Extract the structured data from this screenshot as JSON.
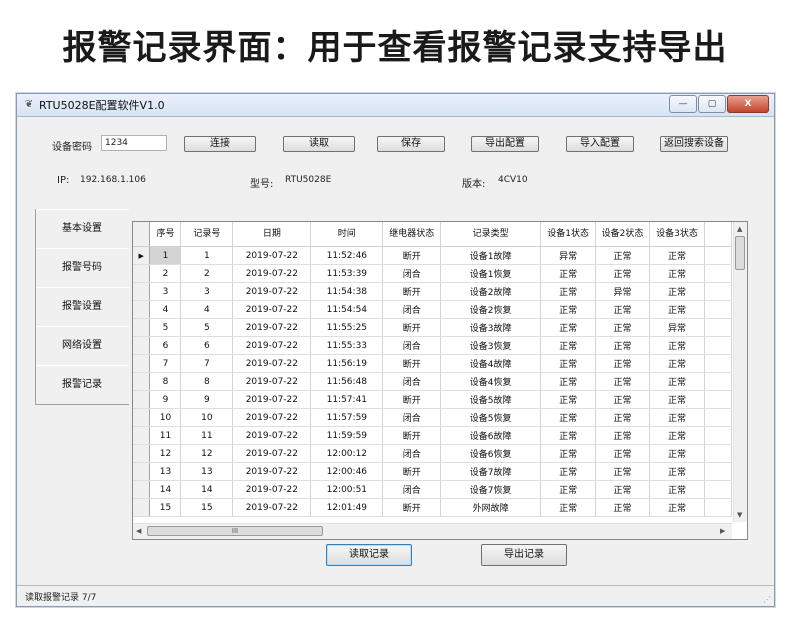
{
  "banner": {
    "title": "报警记录界面：用于查看报警记录支持导出"
  },
  "window": {
    "title": "RTU5028E配置软件V1.0",
    "icon": "app-icon",
    "buttons": {
      "minimize": "—",
      "maximize": "▢",
      "close": "X"
    }
  },
  "top": {
    "password_label": "设备密码",
    "password_value": "1234",
    "buttons": {
      "connect": "连接",
      "read": "读取",
      "save": "保存",
      "export_config": "导出配置",
      "import_config": "导入配置",
      "back_search": "返回搜索设备"
    },
    "ip_label": "IP:",
    "ip_value": "192.168.1.106",
    "model_label": "型号:",
    "model_value": "RTU5028E",
    "version_label": "版本:",
    "version_value": "4CV10"
  },
  "nav": {
    "items": [
      "基本设置",
      "报警号码",
      "报警设置",
      "网络设置",
      "报警记录"
    ],
    "active": 4
  },
  "table": {
    "columns": [
      {
        "key": "no",
        "label": "序号"
      },
      {
        "key": "rec",
        "label": "记录号"
      },
      {
        "key": "date",
        "label": "日期"
      },
      {
        "key": "time",
        "label": "时间"
      },
      {
        "key": "relay",
        "label": "继电器状态"
      },
      {
        "key": "type",
        "label": "记录类型"
      },
      {
        "key": "d1",
        "label": "设备1状态"
      },
      {
        "key": "d2",
        "label": "设备2状态"
      },
      {
        "key": "d3",
        "label": "设备3状态"
      }
    ],
    "rows": [
      [
        "1",
        "1",
        "2019-07-22",
        "11:52:46",
        "断开",
        "设备1故障",
        "异常",
        "正常",
        "正常"
      ],
      [
        "2",
        "2",
        "2019-07-22",
        "11:53:39",
        "闭合",
        "设备1恢复",
        "正常",
        "正常",
        "正常"
      ],
      [
        "3",
        "3",
        "2019-07-22",
        "11:54:38",
        "断开",
        "设备2故障",
        "正常",
        "异常",
        "正常"
      ],
      [
        "4",
        "4",
        "2019-07-22",
        "11:54:54",
        "闭合",
        "设备2恢复",
        "正常",
        "正常",
        "正常"
      ],
      [
        "5",
        "5",
        "2019-07-22",
        "11:55:25",
        "断开",
        "设备3故障",
        "正常",
        "正常",
        "异常"
      ],
      [
        "6",
        "6",
        "2019-07-22",
        "11:55:33",
        "闭合",
        "设备3恢复",
        "正常",
        "正常",
        "正常"
      ],
      [
        "7",
        "7",
        "2019-07-22",
        "11:56:19",
        "断开",
        "设备4故障",
        "正常",
        "正常",
        "正常"
      ],
      [
        "8",
        "8",
        "2019-07-22",
        "11:56:48",
        "闭合",
        "设备4恢复",
        "正常",
        "正常",
        "正常"
      ],
      [
        "9",
        "9",
        "2019-07-22",
        "11:57:41",
        "断开",
        "设备5故障",
        "正常",
        "正常",
        "正常"
      ],
      [
        "10",
        "10",
        "2019-07-22",
        "11:57:59",
        "闭合",
        "设备5恢复",
        "正常",
        "正常",
        "正常"
      ],
      [
        "11",
        "11",
        "2019-07-22",
        "11:59:59",
        "断开",
        "设备6故障",
        "正常",
        "正常",
        "正常"
      ],
      [
        "12",
        "12",
        "2019-07-22",
        "12:00:12",
        "闭合",
        "设备6恢复",
        "正常",
        "正常",
        "正常"
      ],
      [
        "13",
        "13",
        "2019-07-22",
        "12:00:46",
        "断开",
        "设备7故障",
        "正常",
        "正常",
        "正常"
      ],
      [
        "14",
        "14",
        "2019-07-22",
        "12:00:51",
        "闭合",
        "设备7恢复",
        "正常",
        "正常",
        "正常"
      ],
      [
        "15",
        "15",
        "2019-07-22",
        "12:01:49",
        "断开",
        "外网故障",
        "正常",
        "正常",
        "正常"
      ]
    ],
    "selected_row": 0,
    "row_indicator": "▶",
    "hscroll_grip": "III"
  },
  "bottom": {
    "read_records": "读取记录",
    "export_records": "导出记录"
  },
  "status": {
    "text": "读取报警记录 7/7"
  },
  "colors": {
    "window_bg": "#f0f0f0",
    "titlebar": "#dbe6f4",
    "close_button": "#c4452c"
  }
}
